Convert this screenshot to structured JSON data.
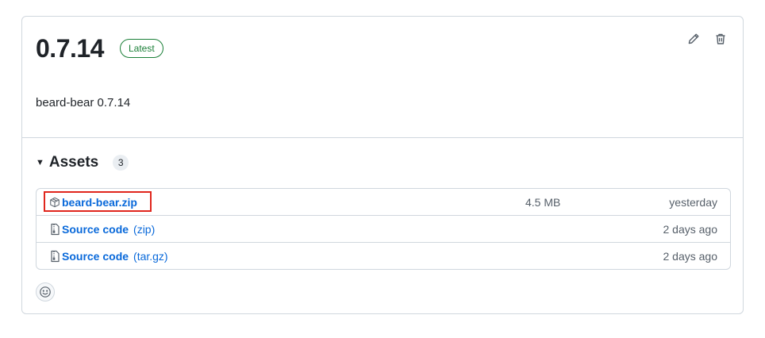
{
  "release": {
    "version": "0.7.14",
    "badge": "Latest",
    "body": "beard-bear 0.7.14",
    "edit_icon": "pencil-icon",
    "delete_icon": "trash-icon"
  },
  "assets": {
    "title": "Assets",
    "count": "3",
    "items": [
      {
        "name": "beard-bear.zip",
        "suffix": "",
        "size": "4.5 MB",
        "date": "yesterday",
        "icon": "package-icon"
      },
      {
        "name": "Source code",
        "suffix": "(zip)",
        "size": "",
        "date": "2 days ago",
        "icon": "file-zip-icon"
      },
      {
        "name": "Source code",
        "suffix": "(tar.gz)",
        "size": "",
        "date": "2 days ago",
        "icon": "file-zip-icon"
      }
    ]
  },
  "reaction": {
    "icon": "smiley-icon"
  },
  "colors": {
    "link": "#0969da",
    "badge_green": "#1a7f37",
    "highlight": "#e0261d",
    "border": "#d0d7de"
  }
}
